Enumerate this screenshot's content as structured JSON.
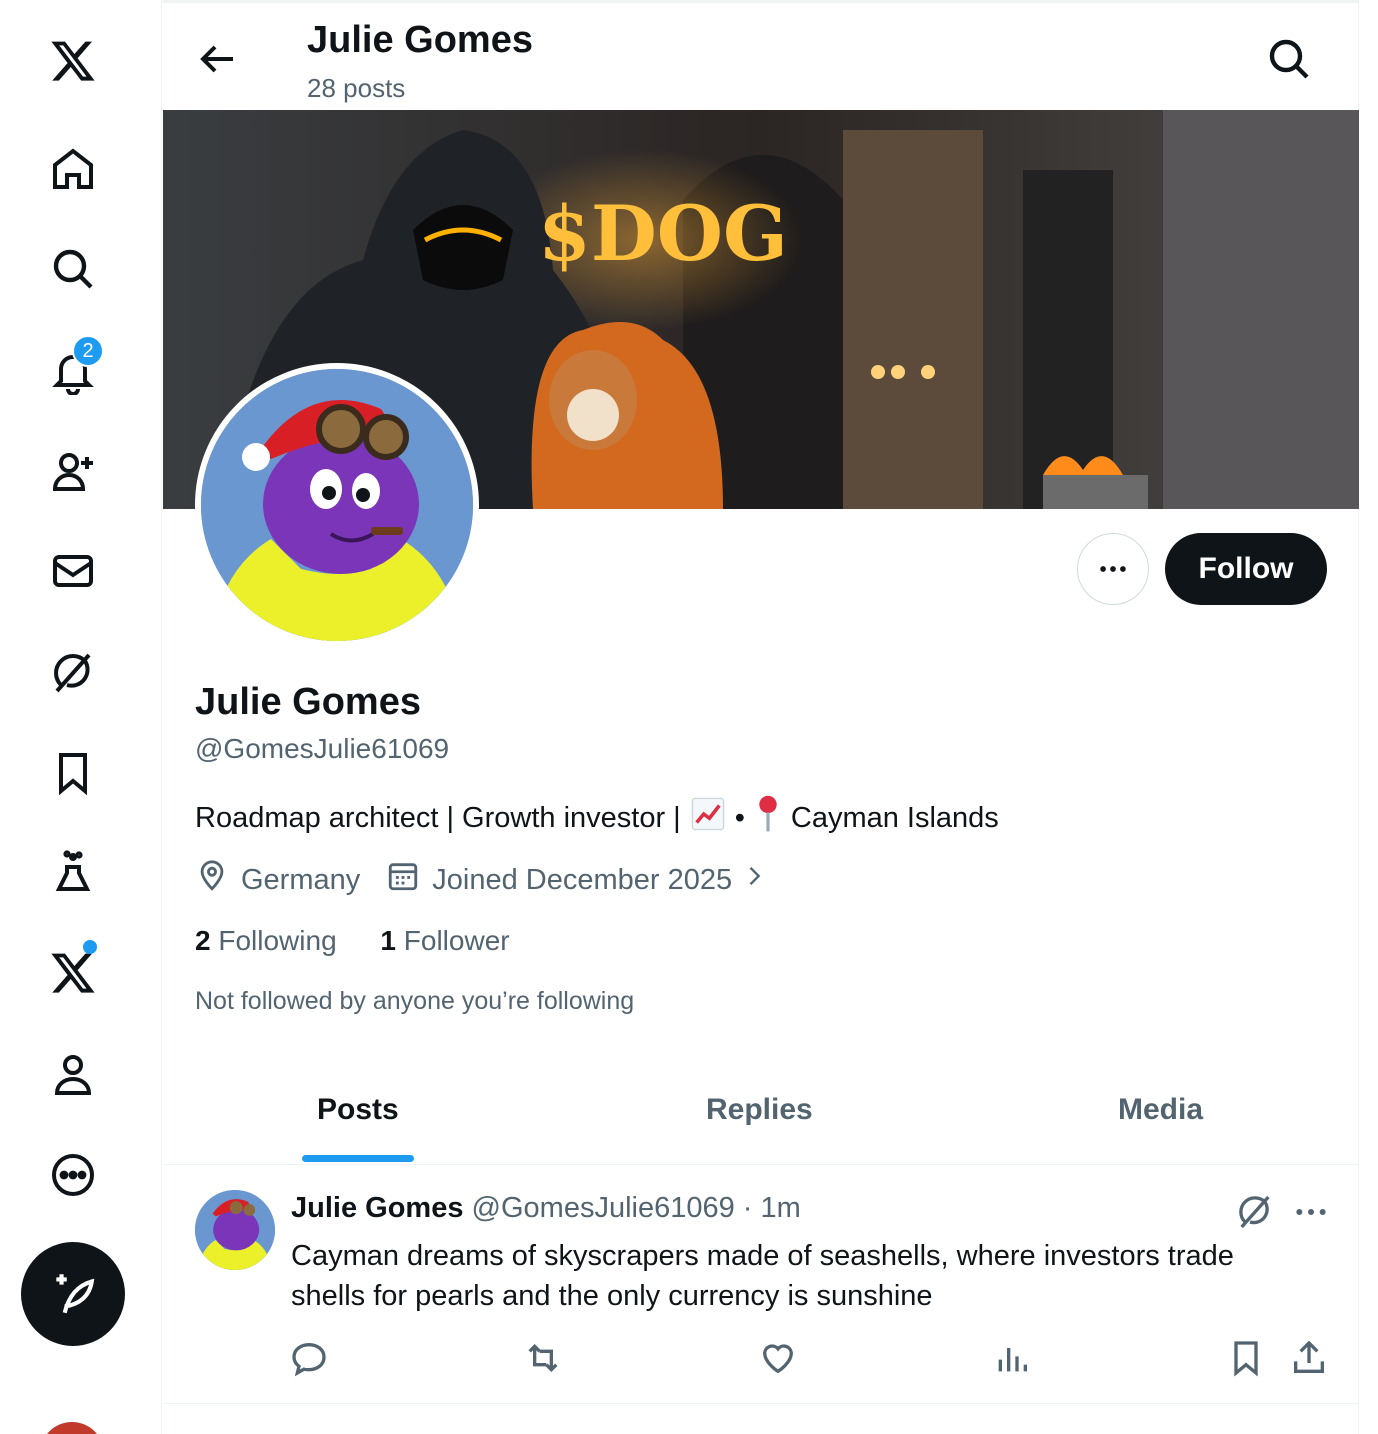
{
  "nav": {
    "items": [
      "x-logo-icon",
      "home-icon",
      "explore-icon",
      "notifications-icon",
      "follow-icon",
      "messages-icon",
      "grok-icon",
      "bookmarks-icon",
      "labs-icon",
      "premium-icon",
      "profile-icon",
      "more-icon"
    ],
    "notification_count": "2"
  },
  "header": {
    "name": "Julie Gomes",
    "posts_count": "28 posts"
  },
  "banner": {
    "text": "$DOG"
  },
  "actions": {
    "follow_label": "Follow"
  },
  "profile": {
    "name": "Julie Gomes",
    "handle": "@GomesJulie61069",
    "bio_part1": "Roadmap architect | Growth investor |",
    "bio_sep": "•",
    "bio_part2": "Cayman Islands",
    "location": "Germany",
    "joined": "Joined December 2025",
    "following_count": "2",
    "following_label": "Following",
    "followers_count": "1",
    "followers_label": "Follower",
    "not_followed": "Not followed by anyone you’re following"
  },
  "tabs": [
    {
      "label": "Posts"
    },
    {
      "label": "Replies"
    },
    {
      "label": "Media"
    }
  ],
  "post": {
    "name": "Julie Gomes",
    "meta": "@GomesJulie61069 · 1m",
    "text": "Cayman dreams of skyscrapers made of seashells, where investors trade shells for pearls and the only currency is sunshine"
  },
  "colors": {
    "accent": "#1d9bf0",
    "text": "#0f1419",
    "secondary": "#536471"
  }
}
